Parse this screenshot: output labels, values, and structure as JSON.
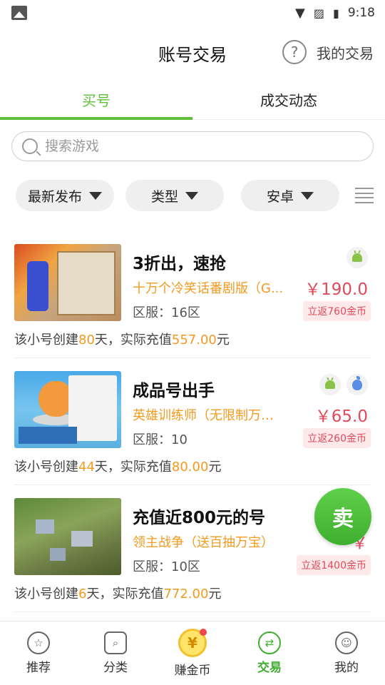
{
  "status": {
    "time": "9:18"
  },
  "header": {
    "title": "账号交易",
    "help_glyph": "?",
    "my_trade": "我的交易"
  },
  "tabs": [
    {
      "label": "买号",
      "active": true
    },
    {
      "label": "成交动态",
      "active": false
    }
  ],
  "search": {
    "placeholder": "搜索游戏"
  },
  "filters": [
    {
      "label": "最新发布"
    },
    {
      "label": "类型"
    },
    {
      "label": "安卓"
    }
  ],
  "items": [
    {
      "title": "3折出，速抢",
      "game": "十万个冷笑话番剧版（G...",
      "server": "区服：16区",
      "price": "￥190.0",
      "rebate": "立返760金币",
      "platforms": [
        "android-icon"
      ],
      "desc_pre": "该小号创建",
      "days": "80",
      "desc_mid": "天，实际充值",
      "recharge": "557.00",
      "desc_post": "元"
    },
    {
      "title": "成品号出手",
      "game": "英雄训练师（无限制万抽...",
      "server": "区服：10",
      "price": "￥65.0",
      "rebate": "立返260金币",
      "platforms": [
        "android-icon",
        "apple-icon"
      ],
      "desc_pre": "该小号创建",
      "days": "44",
      "desc_mid": "天，实际充值",
      "recharge": "80.00",
      "desc_post": "元"
    },
    {
      "title": "充值近800元的号",
      "game": "领主战争（送百抽万宝）",
      "server": "区服：10区",
      "price": "￥",
      "rebate": "立返1400金币",
      "platforms": [],
      "desc_pre": "该小号创建",
      "days": "6",
      "desc_mid": "天，实际充值",
      "recharge": "772.00",
      "desc_post": "元"
    }
  ],
  "sell_button": "卖",
  "bottom_nav": [
    {
      "label": "推荐",
      "icon": "star-icon",
      "glyph": "☆"
    },
    {
      "label": "分类",
      "icon": "category-search-icon",
      "glyph": "⌕"
    },
    {
      "label": "赚金币",
      "icon": "coin-icon",
      "glyph": "¥"
    },
    {
      "label": "交易",
      "icon": "trade-icon",
      "glyph": "⇄",
      "active": true
    },
    {
      "label": "我的",
      "icon": "profile-icon",
      "glyph": "☺"
    }
  ],
  "colors": {
    "accent": "#5fbf3a",
    "price": "#e04a5a",
    "highlight": "#f39a1e"
  }
}
